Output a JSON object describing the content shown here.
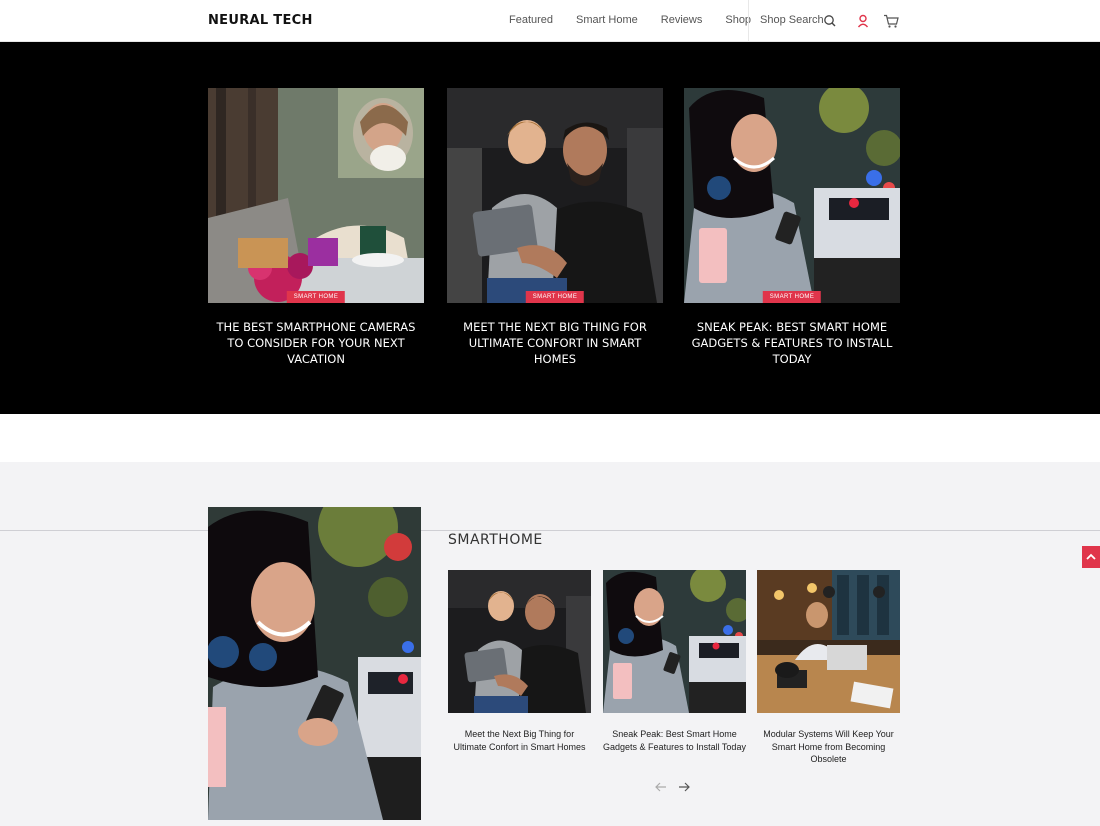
{
  "header": {
    "brand": "NEURAL TECH",
    "nav": [
      "Featured",
      "Smart Home",
      "Reviews",
      "Shop"
    ],
    "shop_search": "Shop Search"
  },
  "hero": {
    "cards": [
      {
        "badge": "SMART HOME",
        "title": "THE BEST SMARTPHONE CAMERAS TO CONSIDER FOR YOUR NEXT VACATION"
      },
      {
        "badge": "SMART HOME",
        "title": "MEET THE NEXT BIG THING FOR ULTIMATE CONFORT IN SMART HOMES"
      },
      {
        "badge": "SMART HOME",
        "title": "SNEAK PEAK: BEST SMART HOME GADGETS & FEATURES TO INSTALL TODAY"
      }
    ]
  },
  "smarthome": {
    "title": "SMARTHOME",
    "cards": [
      {
        "title": "Meet the Next Big Thing for Ultimate Confort in Smart Homes"
      },
      {
        "title": "Sneak Peak: Best Smart Home Gadgets & Features to Install Today"
      },
      {
        "title": "Modular Systems Will Keep Your Smart Home from Becoming Obsolete"
      }
    ]
  },
  "colors": {
    "accent": "#e0354b",
    "hero_bg": "#000000",
    "section_bg": "#f3f3f5"
  },
  "icons": [
    "search-icon",
    "user-icon",
    "cart-icon",
    "arrow-left-icon",
    "arrow-right-icon",
    "chevron-up-icon"
  ]
}
